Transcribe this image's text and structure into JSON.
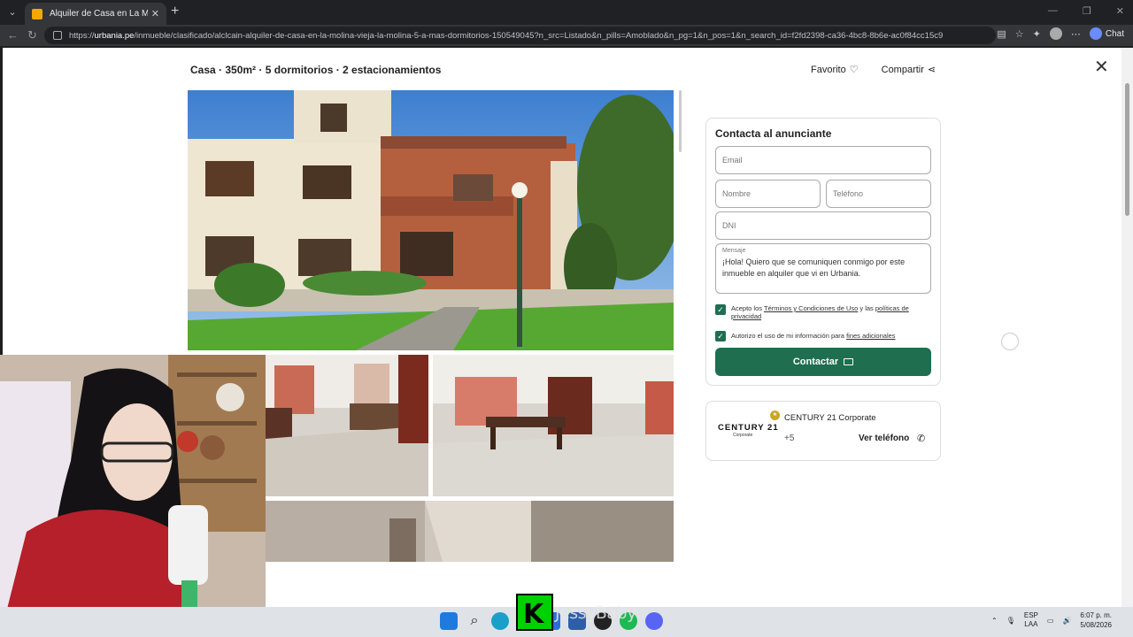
{
  "browser": {
    "tab_title": "Alquiler de Casa en La Molina - Li",
    "url_prefix": "https://",
    "url_domain": "urbania.pe",
    "url_path": "/inmueble/clasificado/alclcain-alquiler-de-casa-en-la-molina-vieja-la-molina-5-a-mas-dormitorios-150549045?n_src=Listado&n_pills=Amoblado&n_pg=1&n_pos=1&n_search_id=f2fd2398-ca36-4bc8-8b6e-ac0f84cc15c9",
    "chat_label": "Chat"
  },
  "listing": {
    "title": "Casa · 350m² · 5 dormitorios · 2 estacionamientos",
    "favorite_label": "Favorito",
    "share_label": "Compartir"
  },
  "contact": {
    "title": "Contacta al anunciante",
    "email_placeholder": "Email",
    "name_placeholder": "Nombre",
    "phone_placeholder": "Teléfono",
    "dni_placeholder": "DNI",
    "message_label": "Mensaje",
    "message_text": "¡Hola! Quiero que se comuniquen conmigo por este inmueble en alquiler que vi en Urbania.",
    "terms_prefix": "Acepto los",
    "terms_link": "Términos y Condiciones de Uso",
    "terms_middle": "y las",
    "privacy_link": "políticas de privacidad",
    "consent_prefix": "Autorizo el uso de mi información para",
    "consent_link": "fines adicionales",
    "button_label": "Contactar"
  },
  "agency": {
    "logo_text": "CENTURY 21",
    "logo_sub": "Corporate",
    "name": "CENTURY 21 Corporate",
    "phone_partial": "+5",
    "view_phone_label": "Ver teléfono"
  },
  "overlay": {
    "streamer_name": "JessyBaby",
    "logo_letter": "K"
  },
  "taskbar": {
    "lang_top": "ESP",
    "lang_bottom": "LAA",
    "time": "6:07 p. m.",
    "date": "5/08/2026"
  },
  "colors": {
    "accent": "#1e6e4f",
    "badge": "#c9a825"
  }
}
